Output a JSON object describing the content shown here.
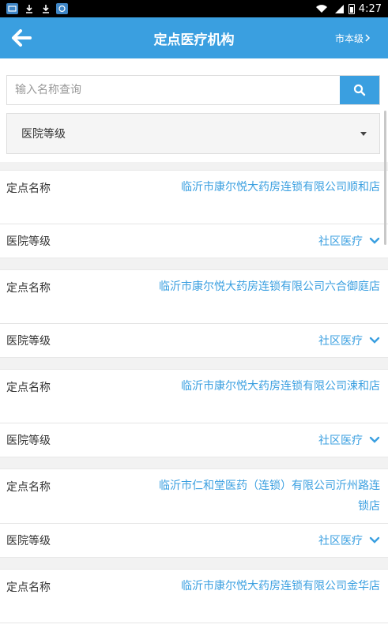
{
  "status_bar": {
    "time": "4:27"
  },
  "header": {
    "title": "定点医疗机构",
    "region": "市本级"
  },
  "search": {
    "placeholder": "输入名称查询",
    "value": ""
  },
  "filter": {
    "selected": "医院等级"
  },
  "labels": {
    "name": "定点名称",
    "level": "医院等级"
  },
  "results": [
    {
      "name": "临沂市康尔悦大药房连锁有限公司顺和店",
      "level": "社区医疗"
    },
    {
      "name": "临沂市康尔悦大药房连锁有限公司六合御庭店",
      "level": "社区医疗"
    },
    {
      "name": "临沂市康尔悦大药房连锁有限公司涑和店",
      "level": "社区医疗"
    },
    {
      "name": "临沂市仁和堂医药（连锁）有限公司沂州路连锁店",
      "level": "社区医疗"
    },
    {
      "name": "临沂市康尔悦大药房连锁有限公司金华店",
      "level": "社区医疗"
    }
  ],
  "colors": {
    "accent": "#3a9fe0",
    "status_bar": "#000000"
  }
}
